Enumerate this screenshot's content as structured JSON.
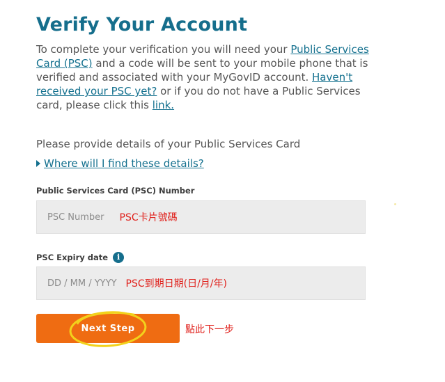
{
  "page": {
    "title": "Verify Your Account"
  },
  "intro": {
    "part1": "To complete your verification you will need your ",
    "link_psc": "Public Services Card (PSC)",
    "part2": " and a code will be sent to your mobile phone that is verified and associated with your MyGovID account. ",
    "link_havent": "Haven't received your PSC yet?",
    "part3": " or if you do not have a Public Services card, please click this ",
    "link_link": "link."
  },
  "form": {
    "provide_text": "Please provide details of your Public Services Card",
    "details_link": "Where will I find these details?",
    "psc_label": "Public Services Card (PSC) Number",
    "psc_placeholder": "PSC Number",
    "expiry_label": "PSC Expiry date",
    "expiry_placeholder": "DD / MM / YYYY",
    "info_icon_glyph": "i",
    "next_button": "Next Step"
  },
  "annotations": {
    "psc_note": "PSC卡片號碼",
    "expiry_note": "PSC到期日期(日/月/年)",
    "button_note": "點此下一步",
    "color": "#e0201b",
    "highlight_color": "#f2d21c"
  },
  "colors": {
    "title": "#156e8c",
    "link": "#15718f",
    "button": "#ef6c12",
    "field_bg": "#ececec"
  },
  "icons": {
    "expand": "triangle-right-icon",
    "info": "info-icon"
  }
}
